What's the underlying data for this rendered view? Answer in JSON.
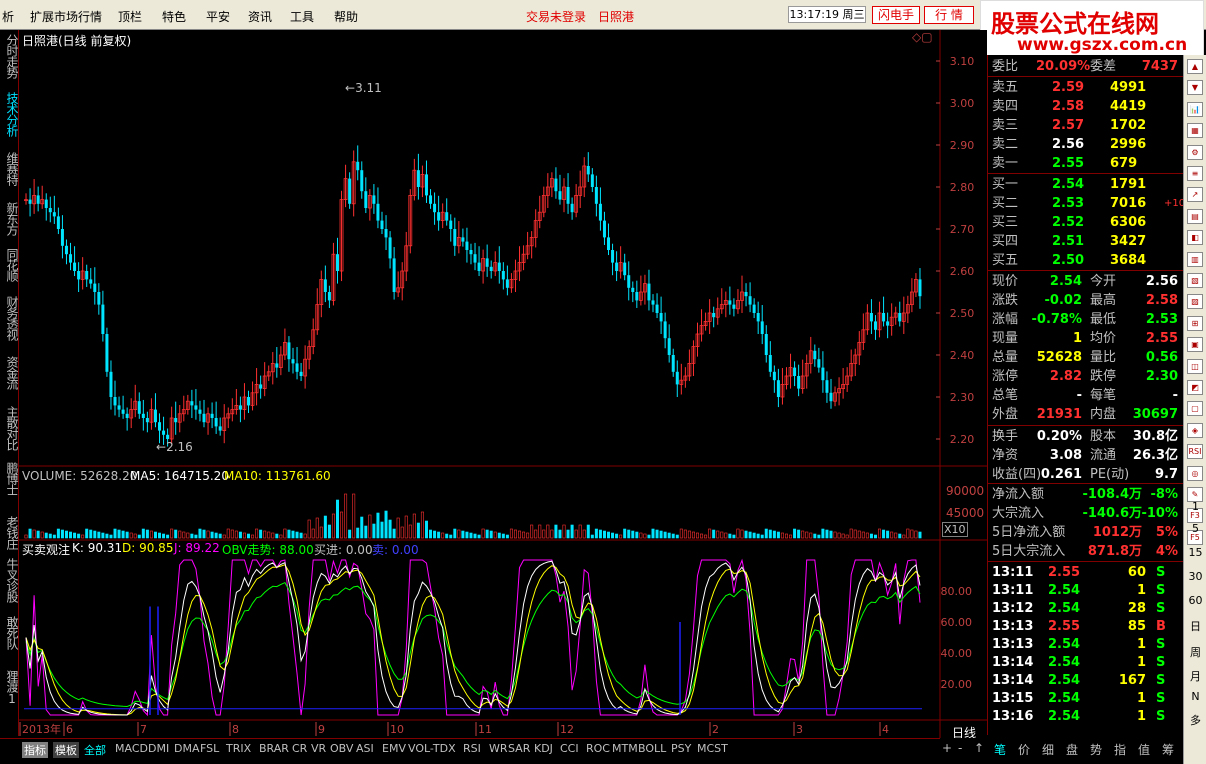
{
  "menu": {
    "items": [
      "析",
      "扩展市场行情",
      "顶栏",
      "特色",
      "平安",
      "资讯",
      "工具",
      "帮助"
    ],
    "trade_status": "交易未登录",
    "stock_name_top": "日照港",
    "clock": "13:17:19 周三",
    "flash_btn": "闪电手",
    "quote_btn": "行 情"
  },
  "logo": {
    "line1": "股票公式在线网",
    "line2": "www.gszx.com.cn"
  },
  "left_nav": [
    "分时走势",
    "技术分析",
    "维赛特",
    "新东方",
    "同花顺",
    "财务透视",
    "资金流",
    "主散对比",
    "鹏博士",
    "老钱庄",
    "牛叉诊股",
    "敢死队",
    "狸渡1"
  ],
  "main_chart": {
    "title": "日照港(日线 前复权)",
    "high_label": "3.11",
    "low_label": "2.16",
    "price_ticks": [
      "3.10",
      "3.00",
      "2.90",
      "2.80",
      "2.70",
      "2.60",
      "2.50",
      "2.40",
      "2.30",
      "2.20"
    ]
  },
  "volume": {
    "label": "VOLUME: 52628.20",
    "ma5": "MA5: 164715.20",
    "ma10": "MA10: 113761.60",
    "ticks": [
      "90000",
      "45000"
    ],
    "unit": "X10"
  },
  "indicator": {
    "name": "买卖观注",
    "k": "K: 90.31",
    "d": "D: 90.85",
    "j": "J: 89.22",
    "obv": "OBV走势: 88.00",
    "buy": "买进: 0.00",
    "sell": "卖: 0.00",
    "ticks": [
      "80.00",
      "60.00",
      "40.00",
      "20.00"
    ]
  },
  "x_axis": {
    "labels": [
      "2013年",
      "6",
      "7",
      "8",
      "9",
      "10",
      "11",
      "12",
      "2",
      "3",
      "4"
    ],
    "period": "日线"
  },
  "order_book": {
    "ratio_label": "委比",
    "ratio": "20.09%",
    "diff_label": "委差",
    "diff": "7437",
    "asks": [
      {
        "label": "卖五",
        "price": "2.59",
        "vol": "4991"
      },
      {
        "label": "卖四",
        "price": "2.58",
        "vol": "4419"
      },
      {
        "label": "卖三",
        "price": "2.57",
        "vol": "1702"
      },
      {
        "label": "卖二",
        "price": "2.56",
        "vol": "2996"
      },
      {
        "label": "卖一",
        "price": "2.55",
        "vol": "679"
      }
    ],
    "bids": [
      {
        "label": "买一",
        "price": "2.54",
        "vol": "1791",
        "extra": ""
      },
      {
        "label": "买二",
        "price": "2.53",
        "vol": "7016",
        "extra": "+10"
      },
      {
        "label": "买三",
        "price": "2.52",
        "vol": "6306",
        "extra": ""
      },
      {
        "label": "买四",
        "price": "2.51",
        "vol": "3427",
        "extra": ""
      },
      {
        "label": "买五",
        "price": "2.50",
        "vol": "3684",
        "extra": ""
      }
    ]
  },
  "stats": [
    {
      "l1": "现价",
      "v1": "2.54",
      "l2": "今开",
      "v2": "2.56",
      "c1": "#00ff00",
      "c2": "#ffffff"
    },
    {
      "l1": "涨跌",
      "v1": "-0.02",
      "l2": "最高",
      "v2": "2.58",
      "c1": "#00ff00",
      "c2": "#ff3030"
    },
    {
      "l1": "涨幅",
      "v1": "-0.78%",
      "l2": "最低",
      "v2": "2.53",
      "c1": "#00ff00",
      "c2": "#00ff00"
    },
    {
      "l1": "现量",
      "v1": "1",
      "l2": "均价",
      "v2": "2.55",
      "c1": "#ffff00",
      "c2": "#ff3030"
    },
    {
      "l1": "总量",
      "v1": "52628",
      "l2": "量比",
      "v2": "0.56",
      "c1": "#ffff00",
      "c2": "#00ff00"
    },
    {
      "l1": "涨停",
      "v1": "2.82",
      "l2": "跌停",
      "v2": "2.30",
      "c1": "#ff3030",
      "c2": "#00ff00"
    },
    {
      "l1": "总笔",
      "v1": "-",
      "l2": "每笔",
      "v2": "-",
      "c1": "#ffffff",
      "c2": "#ffffff"
    },
    {
      "l1": "外盘",
      "v1": "21931",
      "l2": "内盘",
      "v2": "30697",
      "c1": "#ff3030",
      "c2": "#00ff00"
    }
  ],
  "info": [
    {
      "l1": "换手",
      "v1": "0.20%",
      "l2": "股本",
      "v2": "30.8亿"
    },
    {
      "l1": "净资",
      "v1": "3.08",
      "l2": "流通",
      "v2": "26.3亿"
    },
    {
      "l1": "收益(四)",
      "v1": "0.261",
      "l2": "PE(动)",
      "v2": "9.7"
    }
  ],
  "flows": [
    {
      "label": "净流入额",
      "val": "-108.4万",
      "pct": "-8%",
      "color": "#00ff00"
    },
    {
      "label": "大宗流入",
      "val": "-140.6万",
      "pct": "-10%",
      "color": "#00ff00"
    },
    {
      "label": "5日净流入额",
      "val": "1012万",
      "pct": "5%",
      "color": "#ff3030"
    },
    {
      "label": "5日大宗流入",
      "val": "871.8万",
      "pct": "4%",
      "color": "#ff3030"
    }
  ],
  "ticks": [
    {
      "t": "13:11",
      "p": "2.55",
      "v": "60",
      "s": "S",
      "sc": "#00ff00"
    },
    {
      "t": "13:11",
      "p": "2.54",
      "v": "1",
      "s": "S",
      "sc": "#00ff00"
    },
    {
      "t": "13:12",
      "p": "2.54",
      "v": "28",
      "s": "S",
      "sc": "#00ff00"
    },
    {
      "t": "13:13",
      "p": "2.55",
      "v": "85",
      "s": "B",
      "sc": "#ff3030"
    },
    {
      "t": "13:13",
      "p": "2.54",
      "v": "1",
      "s": "S",
      "sc": "#00ff00"
    },
    {
      "t": "13:14",
      "p": "2.54",
      "v": "1",
      "s": "S",
      "sc": "#00ff00"
    },
    {
      "t": "13:14",
      "p": "2.54",
      "v": "167",
      "s": "S",
      "sc": "#00ff00"
    },
    {
      "t": "13:15",
      "p": "2.54",
      "v": "1",
      "s": "S",
      "sc": "#00ff00"
    },
    {
      "t": "13:16",
      "p": "2.54",
      "v": "1",
      "s": "S",
      "sc": "#00ff00"
    }
  ],
  "right_toolbar": [
    "1",
    "5",
    "15",
    "30",
    "60",
    "日",
    "周",
    "月",
    "N",
    "多"
  ],
  "bottom_tabs": [
    "指标",
    "模板",
    "全部",
    "MACD",
    "DMI",
    "DMA",
    "FSL",
    "TRIX",
    "BRAR",
    "CR",
    "VR",
    "OBV",
    "ASI",
    "EMV",
    "VOL-TDX",
    "RSI",
    "WR",
    "SAR",
    "KDJ",
    "CCI",
    "ROC",
    "MTM",
    "BOLL",
    "PSY",
    "MCST"
  ],
  "bottom_right": [
    "+",
    "-",
    "↑",
    "笔",
    "价",
    "细",
    "盘",
    "势",
    "指",
    "值",
    "筹"
  ],
  "chart_data": {
    "type": "candlestick",
    "title": "日照港(日线 前复权)",
    "ylim": [
      2.15,
      3.15
    ],
    "closes": [
      2.77,
      2.76,
      2.78,
      2.76,
      2.77,
      2.75,
      2.74,
      2.73,
      2.7,
      2.66,
      2.64,
      2.62,
      2.6,
      2.58,
      2.6,
      2.58,
      2.57,
      2.55,
      2.52,
      2.45,
      2.36,
      2.3,
      2.28,
      2.27,
      2.26,
      2.25,
      2.27,
      2.29,
      2.26,
      2.25,
      2.24,
      2.27,
      2.24,
      2.22,
      2.21,
      2.2,
      2.25,
      2.24,
      2.26,
      2.27,
      2.29,
      2.28,
      2.27,
      2.26,
      2.24,
      2.26,
      2.25,
      2.23,
      2.22,
      2.25,
      2.26,
      2.27,
      2.28,
      2.27,
      2.3,
      2.28,
      2.31,
      2.33,
      2.32,
      2.35,
      2.36,
      2.38,
      2.37,
      2.4,
      2.43,
      2.39,
      2.38,
      2.36,
      2.35,
      2.39,
      2.42,
      2.46,
      2.52,
      2.58,
      2.55,
      2.53,
      2.64,
      2.6,
      2.77,
      2.82,
      2.76,
      2.86,
      2.84,
      2.79,
      2.75,
      2.78,
      2.76,
      2.72,
      2.7,
      2.68,
      2.63,
      2.55,
      2.56,
      2.6,
      2.66,
      2.78,
      2.84,
      2.8,
      2.83,
      2.78,
      2.76,
      2.74,
      2.72,
      2.74,
      2.72,
      2.7,
      2.66,
      2.68,
      2.67,
      2.65,
      2.64,
      2.62,
      2.6,
      2.63,
      2.61,
      2.6,
      2.62,
      2.6,
      2.58,
      2.56,
      2.58,
      2.6,
      2.62,
      2.64,
      2.66,
      2.68,
      2.72,
      2.74,
      2.78,
      2.8,
      2.82,
      2.79,
      2.77,
      2.8,
      2.76,
      2.74,
      2.78,
      2.8,
      2.85,
      2.83,
      2.8,
      2.76,
      2.72,
      2.68,
      2.65,
      2.62,
      2.6,
      2.62,
      2.59,
      2.56,
      2.55,
      2.53,
      2.55,
      2.57,
      2.53,
      2.52,
      2.5,
      2.48,
      2.44,
      2.4,
      2.36,
      2.33,
      2.34,
      2.35,
      2.38,
      2.42,
      2.45,
      2.47,
      2.48,
      2.5,
      2.49,
      2.51,
      2.52,
      2.53,
      2.52,
      2.51,
      2.53,
      2.55,
      2.54,
      2.52,
      2.5,
      2.48,
      2.45,
      2.4,
      2.36,
      2.34,
      2.3,
      2.33,
      2.35,
      2.37,
      2.35,
      2.32,
      2.35,
      2.38,
      2.41,
      2.39,
      2.37,
      2.34,
      2.31,
      2.29,
      2.31,
      2.32,
      2.33,
      2.35,
      2.38,
      2.4,
      2.43,
      2.46,
      2.5,
      2.48,
      2.46,
      2.5,
      2.48,
      2.47,
      2.49,
      2.5,
      2.48,
      2.5,
      2.52,
      2.55,
      2.58,
      2.54
    ]
  }
}
